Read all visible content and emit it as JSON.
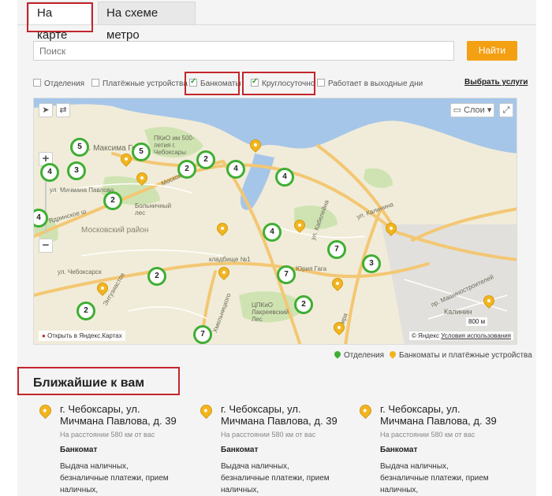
{
  "tabs": [
    {
      "label": "На карте",
      "active": true
    },
    {
      "label": "На схеме метро",
      "active": false
    }
  ],
  "search": {
    "placeholder": "Поиск",
    "value": ""
  },
  "find_button": {
    "label": "Найти"
  },
  "filters": [
    {
      "label": "Отделения",
      "checked": false
    },
    {
      "label": "Платёжные устройства",
      "checked": false
    },
    {
      "label": "Банкоматы",
      "checked": true
    },
    {
      "label": "Круглосуточно",
      "checked": true
    },
    {
      "label": "Работает в выходные дни",
      "checked": false
    }
  ],
  "services_link": "Выбрать услуги",
  "map": {
    "layers_label": "Слои",
    "open_link": "Открыть в Яндекс.Картах",
    "copyright": "© Яндекс",
    "terms": "Условия использования",
    "scale": "800 м",
    "labels": {
      "district": "Московский район",
      "street_gorky": "р. Максима Горь",
      "street_michmana": "ул. Мичмана Павлова",
      "street_yadrinsk": "Ядринское ш",
      "street_moskovsky": "Московский",
      "street_kalinina": "ул. Калинина",
      "street_yuria": "Юрия Гага",
      "street_khmelnitsky": "Хмельницкого",
      "street_mira": "Мира",
      "street_mashinostroiteley": "пр. Машиностроителей",
      "park_500": "ПКиО им 500-летия г. Чебоксары",
      "park_lakreevsky": "ЦПКиО Лакреевский Лес",
      "hospital_forest": "Больничный лес",
      "cemetery": "кладбище №1",
      "street_cheboksary": "ул. Чебоксарск",
      "street_kalinin_label": "Калинин",
      "alley": "ул. Кабелейна",
      "street_entuziastov": "Энтузиастов"
    },
    "clusters": [
      "5",
      "5",
      "4",
      "3",
      "2",
      "2",
      "4",
      "4",
      "2",
      "4",
      "2",
      "4",
      "7",
      "7",
      "3",
      "2",
      "2",
      "7"
    ]
  },
  "legend": {
    "branches": "Отделения",
    "atms": "Банкоматы и платёжные устройства"
  },
  "colors": {
    "accent": "#f3a013",
    "cluster_green": "#3fae33",
    "highlight_red": "#c4252c",
    "pin_yellow": "#f3b51f"
  },
  "nearest": {
    "title": "Ближайшие к вам",
    "cards": [
      {
        "address": "г. Чебоксары, ул. Мичмана Павлова, д. 39",
        "distance": "На расстоянии 580 км от вас",
        "type": "Банкомат",
        "desc": "Выдача наличных, безналичные платежи, прием наличных,"
      },
      {
        "address": "г. Чебоксары, ул. Мичмана Павлова, д. 39",
        "distance": "На расстоянии 580 км от вас",
        "type": "Банкомат",
        "desc": "Выдача наличных, безналичные платежи, прием наличных,"
      },
      {
        "address": "г. Чебоксары, ул. Мичмана Павлова, д. 39",
        "distance": "На расстоянии 580 км от вас",
        "type": "Банкомат",
        "desc": "Выдача наличных, безналичные платежи, прием наличных,"
      }
    ]
  }
}
